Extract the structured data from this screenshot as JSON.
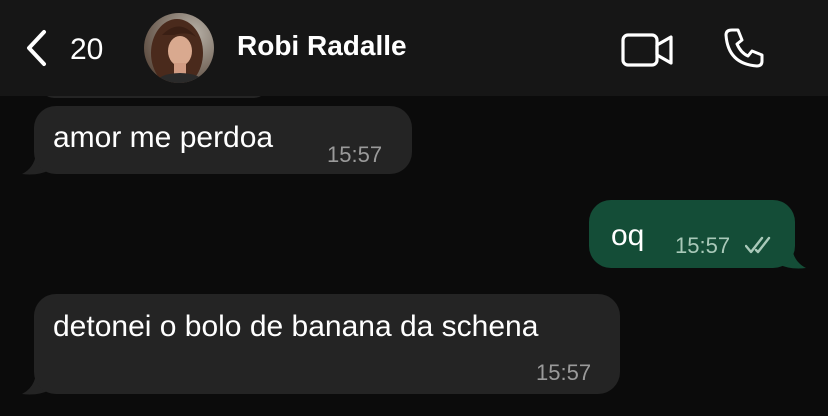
{
  "header": {
    "back_count": "20",
    "contact_name": "Robi Radalle",
    "icons": [
      "chevron-left-icon",
      "avatar",
      "video-camera-icon",
      "phone-icon"
    ]
  },
  "messages": [
    {
      "direction": "incoming",
      "text": "amor me perdoa",
      "time": "15:57"
    },
    {
      "direction": "outgoing",
      "text": "oq",
      "time": "15:57",
      "status": "read"
    },
    {
      "direction": "incoming",
      "text": "detonei o bolo de banana da schena",
      "time": "15:57"
    }
  ],
  "colors": {
    "background": "#0b0b0b",
    "header": "#161616",
    "incoming_bubble": "#242424",
    "outgoing_bubble": "#144d37",
    "timestamp": "#9a9a9a"
  }
}
